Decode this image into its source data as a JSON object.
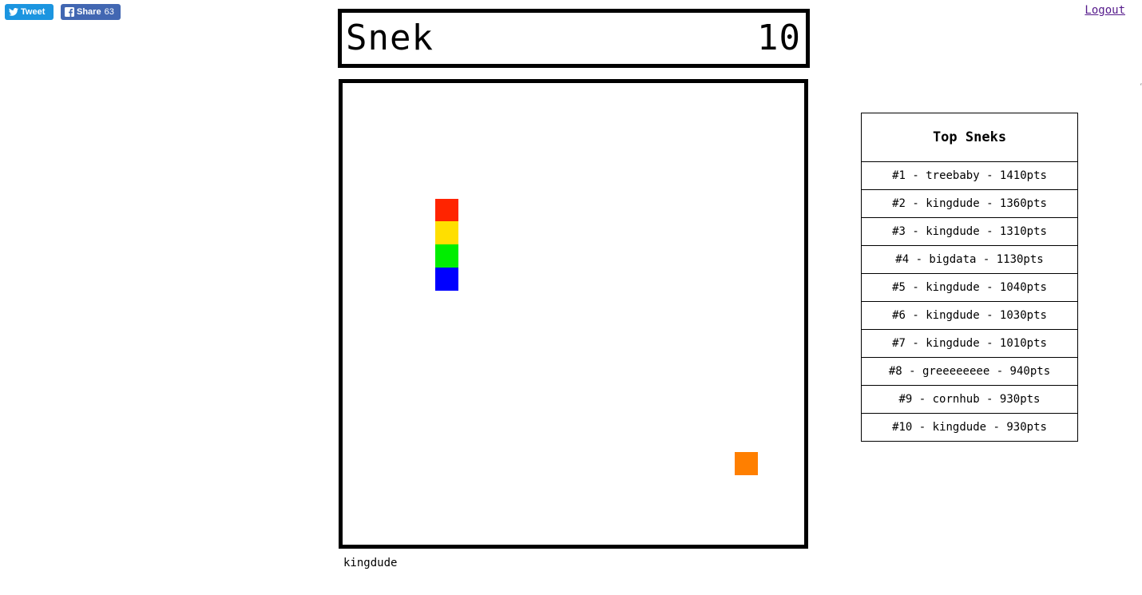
{
  "social": {
    "tweet_label": "Tweet",
    "share_label": "Share",
    "share_count": "63",
    "tweet_color": "#1b95e0",
    "share_color": "#4267b2"
  },
  "nav": {
    "logout_label": "Logout"
  },
  "header": {
    "title": "Snek",
    "score": "10"
  },
  "board": {
    "grid_cells": 20,
    "snake": [
      {
        "col": 4,
        "row": 5,
        "color": "#ff2400"
      },
      {
        "col": 4,
        "row": 6,
        "color": "#ffdf00"
      },
      {
        "col": 4,
        "row": 7,
        "color": "#00ee00"
      },
      {
        "col": 4,
        "row": 8,
        "color": "#0000ff"
      }
    ],
    "food": {
      "col": 17,
      "row": 16,
      "color": "#ff7f00"
    }
  },
  "player": {
    "name": "kingdude"
  },
  "leaderboard": {
    "title": "Top Sneks",
    "entries": [
      "#1 - treebaby - 1410pts",
      "#2 - kingdude - 1360pts",
      "#3 - kingdude - 1310pts",
      "#4 - bigdata - 1130pts",
      "#5 - kingdude - 1040pts",
      "#6 - kingdude - 1030pts",
      "#7 - kingdude - 1010pts",
      "#8 - greeeeeeee - 940pts",
      "#9 - cornhub - 930pts",
      "#10 - kingdude - 930pts"
    ]
  }
}
